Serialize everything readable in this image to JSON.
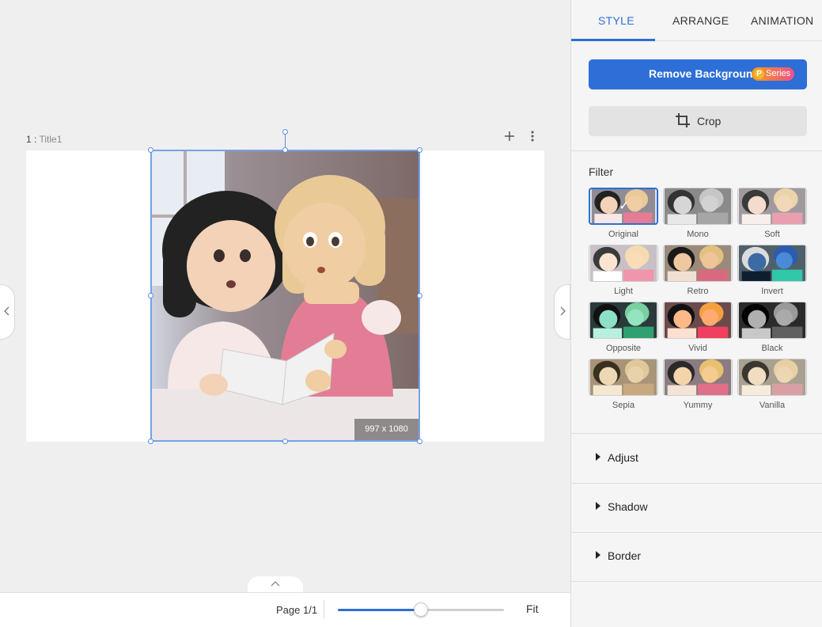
{
  "canvas": {
    "page_number": "1 :",
    "page_name": "Title1",
    "add_page_icon": "plus-icon",
    "more_icon": "more-vertical-icon",
    "image_size": "997 x 1080",
    "prev_icon": "chevron-left-icon",
    "next_icon": "chevron-right-icon"
  },
  "bottom_bar": {
    "pull_up_icon": "chevron-up-icon",
    "page_count": "Page 1/1",
    "zoom_level": 0.5,
    "fit_label": "Fit"
  },
  "panel": {
    "tabs": [
      {
        "label": "STYLE",
        "active": true
      },
      {
        "label": "ARRANGE",
        "active": false
      },
      {
        "label": "ANIMATION",
        "active": false
      }
    ],
    "remove_background": "Remove Background",
    "pseries_letter": "P",
    "pseries_label": "Series",
    "crop_label": "Crop",
    "filter_title": "Filter",
    "filters": [
      {
        "name": "Original",
        "selected": true
      },
      {
        "name": "Mono"
      },
      {
        "name": "Soft"
      },
      {
        "name": "Light"
      },
      {
        "name": "Retro"
      },
      {
        "name": "Invert"
      },
      {
        "name": "Opposite"
      },
      {
        "name": "Vivid"
      },
      {
        "name": "Black"
      },
      {
        "name": "Sepia"
      },
      {
        "name": "Yummy"
      },
      {
        "name": "Vanilla"
      }
    ],
    "sections": [
      {
        "label": "Adjust"
      },
      {
        "label": "Shadow"
      },
      {
        "label": "Border"
      }
    ],
    "colors": {
      "accent": "#2d6fd6",
      "selection": "#74a2ea"
    }
  }
}
